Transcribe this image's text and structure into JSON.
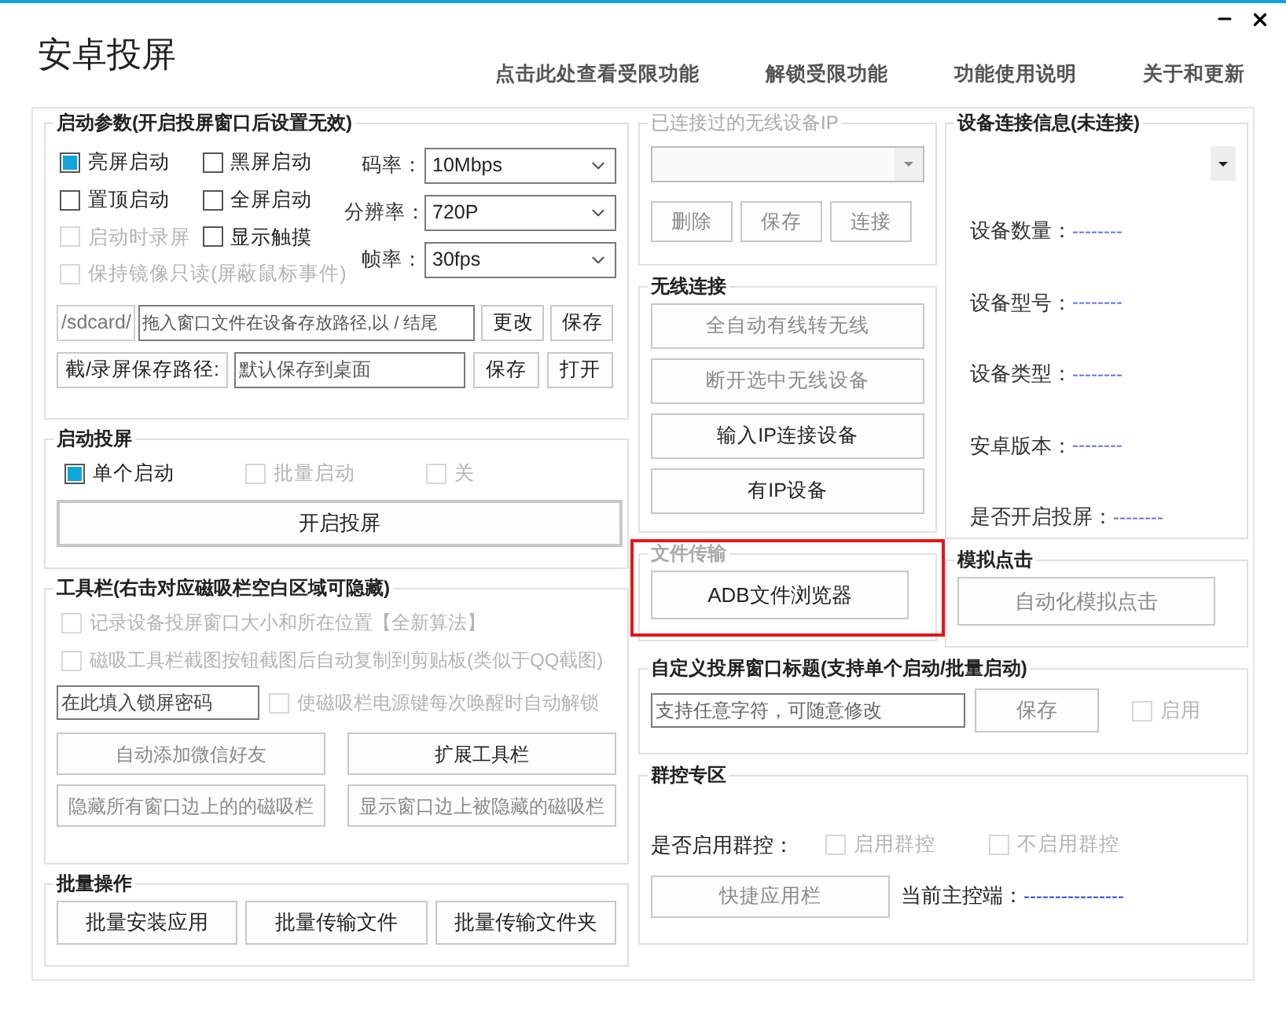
{
  "window": {
    "title": "安卓投屏",
    "links": [
      "点击此处查看受限功能",
      "解锁受限功能",
      "功能使用说明",
      "关于和更新"
    ]
  },
  "launch_params": {
    "title": "启动参数(开启投屏窗口后设置无效)",
    "checkboxes": [
      {
        "label": "亮屏启动",
        "checked": true,
        "disabled": false
      },
      {
        "label": "黑屏启动",
        "checked": false,
        "disabled": false
      },
      {
        "label": "置顶启动",
        "checked": false,
        "disabled": false
      },
      {
        "label": "全屏启动",
        "checked": false,
        "disabled": false
      },
      {
        "label": "启动时录屏",
        "checked": false,
        "disabled": true
      },
      {
        "label": "显示触摸",
        "checked": false,
        "disabled": false
      },
      {
        "label": "保持镜像只读(屏蔽鼠标事件)",
        "checked": false,
        "disabled": true
      }
    ],
    "settings": [
      {
        "label": "码率：",
        "value": "10Mbps"
      },
      {
        "label": "分辨率：",
        "value": "720P"
      },
      {
        "label": "帧率：",
        "value": "30fps"
      }
    ],
    "path_row": {
      "prefix": "/sdcard/",
      "value": "拖入窗口文件在设备存放路径,以 / 结尾",
      "buttons": [
        {
          "label": "更改",
          "disabled": false
        },
        {
          "label": "保存",
          "disabled": false
        }
      ]
    },
    "save_row": {
      "button": {
        "label": "截/录屏保存路径:",
        "disabled": false
      },
      "value": "默认保存到桌面",
      "buttons": [
        {
          "label": "保存",
          "disabled": false
        },
        {
          "label": "打开",
          "disabled": false
        }
      ]
    }
  },
  "launch_screen": {
    "title": "启动投屏",
    "modes": [
      {
        "label": "单个启动",
        "checked": true,
        "disabled": false
      },
      {
        "label": "批量启动",
        "checked": false,
        "disabled": true
      },
      {
        "label": "关",
        "checked": false,
        "disabled": true
      }
    ],
    "button": {
      "label": "开启投屏",
      "disabled": false
    }
  },
  "toolbar": {
    "title": "工具栏(右击对应磁吸栏空白区域可隐藏)",
    "checkboxes": [
      {
        "label": "记录设备投屏窗口大小和所在位置【全新算法】",
        "checked": false,
        "disabled": true
      },
      {
        "label": "磁吸工具栏截图按钮截图后自动复制到剪贴板(类似于QQ截图)",
        "checked": false,
        "disabled": true
      }
    ],
    "password_field": {
      "value": "在此填入锁屏密码"
    },
    "unlock_checkbox": {
      "label": "使磁吸栏电源键每次唤醒时自动解锁",
      "checked": false,
      "disabled": true
    },
    "buttons": [
      {
        "label": "自动添加微信好友",
        "disabled": true
      },
      {
        "label": "扩展工具栏",
        "disabled": false
      },
      {
        "label": "隐藏所有窗口边上的的磁吸栏",
        "disabled": true
      },
      {
        "label": "显示窗口边上被隐藏的磁吸栏",
        "disabled": true
      }
    ]
  },
  "batch": {
    "title": "批量操作",
    "buttons": [
      {
        "label": "批量安装应用",
        "disabled": false
      },
      {
        "label": "批量传输文件",
        "disabled": false
      },
      {
        "label": "批量传输文件夹",
        "disabled": false
      }
    ]
  },
  "wireless_history": {
    "title": "已连接过的无线设备IP",
    "buttons": [
      {
        "label": "删除",
        "disabled": true
      },
      {
        "label": "保存",
        "disabled": true
      },
      {
        "label": "连接",
        "disabled": true
      }
    ]
  },
  "wireless": {
    "title": "无线连接",
    "buttons": [
      {
        "label": "全自动有线转无线",
        "disabled": true
      },
      {
        "label": "断开选中无线设备",
        "disabled": true
      },
      {
        "label": "输入IP连接设备",
        "disabled": false
      },
      {
        "label": "有IP设备",
        "disabled": false
      }
    ]
  },
  "file_transfer": {
    "title": "文件传输",
    "highlighted": true,
    "button": {
      "label": "ADB文件浏览器",
      "disabled": false
    }
  },
  "device_info": {
    "title": "设备连接信息(未连接)",
    "rows": [
      {
        "label": "设备数量：",
        "value": "--------"
      },
      {
        "label": "设备型号：",
        "value": "--------"
      },
      {
        "label": "设备类型：",
        "value": "--------"
      },
      {
        "label": "安卓版本：",
        "value": "--------"
      },
      {
        "label": "是否开启投屏：",
        "value": "--------"
      }
    ]
  },
  "simulate_click": {
    "title": "模拟点击",
    "button": {
      "label": "自动化模拟点击",
      "disabled": true
    }
  },
  "custom_title": {
    "title": "自定义投屏窗口标题(支持单个启动/批量启动)",
    "value": "支持任意字符，可随意修改",
    "button": {
      "label": "保存",
      "disabled": true
    },
    "checkbox": {
      "label": "启用",
      "checked": false,
      "disabled": true
    }
  },
  "group_control": {
    "title": "群控专区",
    "label": "是否启用群控：",
    "options": [
      {
        "label": "启用群控",
        "checked": false,
        "disabled": true
      },
      {
        "label": "不启用群控",
        "checked": false,
        "disabled": true
      }
    ],
    "button": {
      "label": "快捷应用栏",
      "disabled": true
    },
    "master_label": "当前主控端：",
    "master_value": "----------------"
  }
}
